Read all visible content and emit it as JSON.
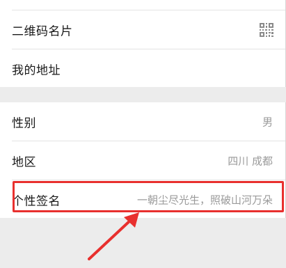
{
  "profile": {
    "group1": [
      {
        "id": "qrcode",
        "label": "二维码名片",
        "icon": "qr-code-icon"
      },
      {
        "id": "address",
        "label": "我的地址"
      }
    ],
    "group2": [
      {
        "id": "gender",
        "label": "性别",
        "value": "男"
      },
      {
        "id": "region",
        "label": "地区",
        "value": "四川 成都"
      },
      {
        "id": "signature",
        "label": "个性签名",
        "value": "一朝尘尽光生，照破山河万朵"
      }
    ]
  },
  "colors": {
    "annotation": "#e8302e",
    "background": "#ececec",
    "row": "#ffffff",
    "value_text": "#9a9a9a"
  }
}
